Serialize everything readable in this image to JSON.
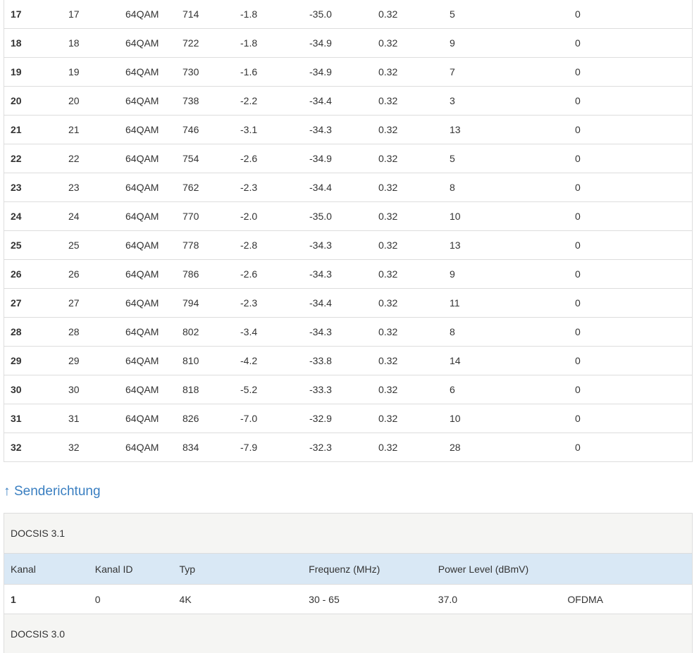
{
  "downstream": {
    "rows": [
      [
        "17",
        "17",
        "64QAM",
        "714",
        "-1.8",
        "-35.0",
        "0.32",
        "5",
        "0"
      ],
      [
        "18",
        "18",
        "64QAM",
        "722",
        "-1.8",
        "-34.9",
        "0.32",
        "9",
        "0"
      ],
      [
        "19",
        "19",
        "64QAM",
        "730",
        "-1.6",
        "-34.9",
        "0.32",
        "7",
        "0"
      ],
      [
        "20",
        "20",
        "64QAM",
        "738",
        "-2.2",
        "-34.4",
        "0.32",
        "3",
        "0"
      ],
      [
        "21",
        "21",
        "64QAM",
        "746",
        "-3.1",
        "-34.3",
        "0.32",
        "13",
        "0"
      ],
      [
        "22",
        "22",
        "64QAM",
        "754",
        "-2.6",
        "-34.9",
        "0.32",
        "5",
        "0"
      ],
      [
        "23",
        "23",
        "64QAM",
        "762",
        "-2.3",
        "-34.4",
        "0.32",
        "8",
        "0"
      ],
      [
        "24",
        "24",
        "64QAM",
        "770",
        "-2.0",
        "-35.0",
        "0.32",
        "10",
        "0"
      ],
      [
        "25",
        "25",
        "64QAM",
        "778",
        "-2.8",
        "-34.3",
        "0.32",
        "13",
        "0"
      ],
      [
        "26",
        "26",
        "64QAM",
        "786",
        "-2.6",
        "-34.3",
        "0.32",
        "9",
        "0"
      ],
      [
        "27",
        "27",
        "64QAM",
        "794",
        "-2.3",
        "-34.4",
        "0.32",
        "11",
        "0"
      ],
      [
        "28",
        "28",
        "64QAM",
        "802",
        "-3.4",
        "-34.3",
        "0.32",
        "8",
        "0"
      ],
      [
        "29",
        "29",
        "64QAM",
        "810",
        "-4.2",
        "-33.8",
        "0.32",
        "14",
        "0"
      ],
      [
        "30",
        "30",
        "64QAM",
        "818",
        "-5.2",
        "-33.3",
        "0.32",
        "6",
        "0"
      ],
      [
        "31",
        "31",
        "64QAM",
        "826",
        "-7.0",
        "-32.9",
        "0.32",
        "10",
        "0"
      ],
      [
        "32",
        "32",
        "64QAM",
        "834",
        "-7.9",
        "-32.3",
        "0.32",
        "28",
        "0"
      ]
    ]
  },
  "upstream": {
    "arrow_icon": "arrow-up-icon",
    "arrow_glyph": "↑",
    "title": "Senderichtung",
    "docsis31": {
      "label": "DOCSIS 3.1",
      "headers": [
        "Kanal",
        "Kanal ID",
        "Typ",
        "Frequenz (MHz)",
        "Power Level (dBmV)",
        ""
      ],
      "rows": [
        [
          "1",
          "0",
          "4K",
          "30 - 65",
          "37.0",
          "OFDMA"
        ]
      ]
    },
    "docsis30": {
      "label": "DOCSIS 3.0"
    }
  },
  "colors": {
    "link": "#3a7fc1",
    "header_bg": "#d9e8f5",
    "group_bg": "#f5f5f3",
    "border": "#dddddd"
  }
}
